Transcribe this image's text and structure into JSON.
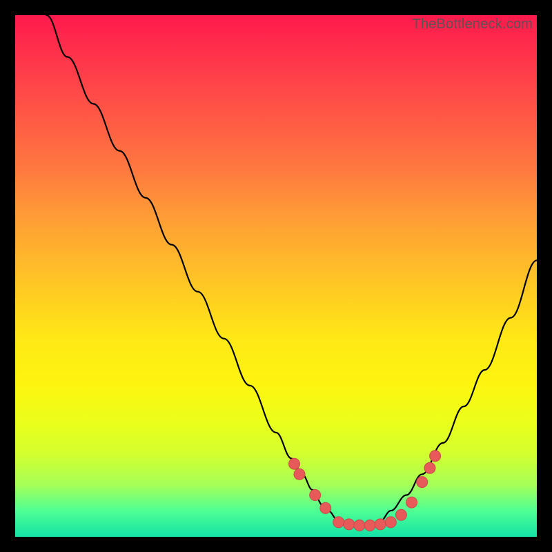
{
  "watermark": "TheBottleneck.com",
  "colors": {
    "point_fill": "#e85a5a",
    "point_stroke": "#c94a4a",
    "curve": "#000000",
    "frame_bg": "#000000"
  },
  "chart_data": {
    "type": "line",
    "title": "",
    "xlabel": "",
    "ylabel": "",
    "xlim": [
      0,
      100
    ],
    "ylim": [
      0,
      100
    ],
    "grid": false,
    "series": [
      {
        "name": "bottleneck-curve",
        "x": [
          6,
          10,
          15,
          20,
          25,
          30,
          35,
          40,
          45,
          50,
          53,
          55,
          57,
          59,
          60,
          62,
          64,
          66,
          68,
          70,
          72,
          75,
          78,
          82,
          86,
          90,
          95,
          100
        ],
        "y": [
          100,
          92,
          83,
          74,
          65,
          56,
          47,
          38,
          29,
          20,
          15,
          12,
          9,
          6,
          5,
          3,
          2,
          2,
          2,
          3,
          5,
          8,
          12,
          18,
          25,
          32,
          42,
          53
        ]
      }
    ],
    "highlight_points": {
      "name": "markers",
      "x": [
        53.5,
        54.5,
        57.5,
        59.5,
        62,
        64,
        66,
        68,
        70,
        72,
        74,
        76,
        78,
        79.5,
        80.5
      ],
      "y": [
        14,
        12,
        8,
        5.5,
        2.8,
        2.4,
        2.2,
        2.2,
        2.4,
        2.8,
        4.2,
        6.6,
        10.5,
        13.2,
        15.5
      ]
    }
  }
}
